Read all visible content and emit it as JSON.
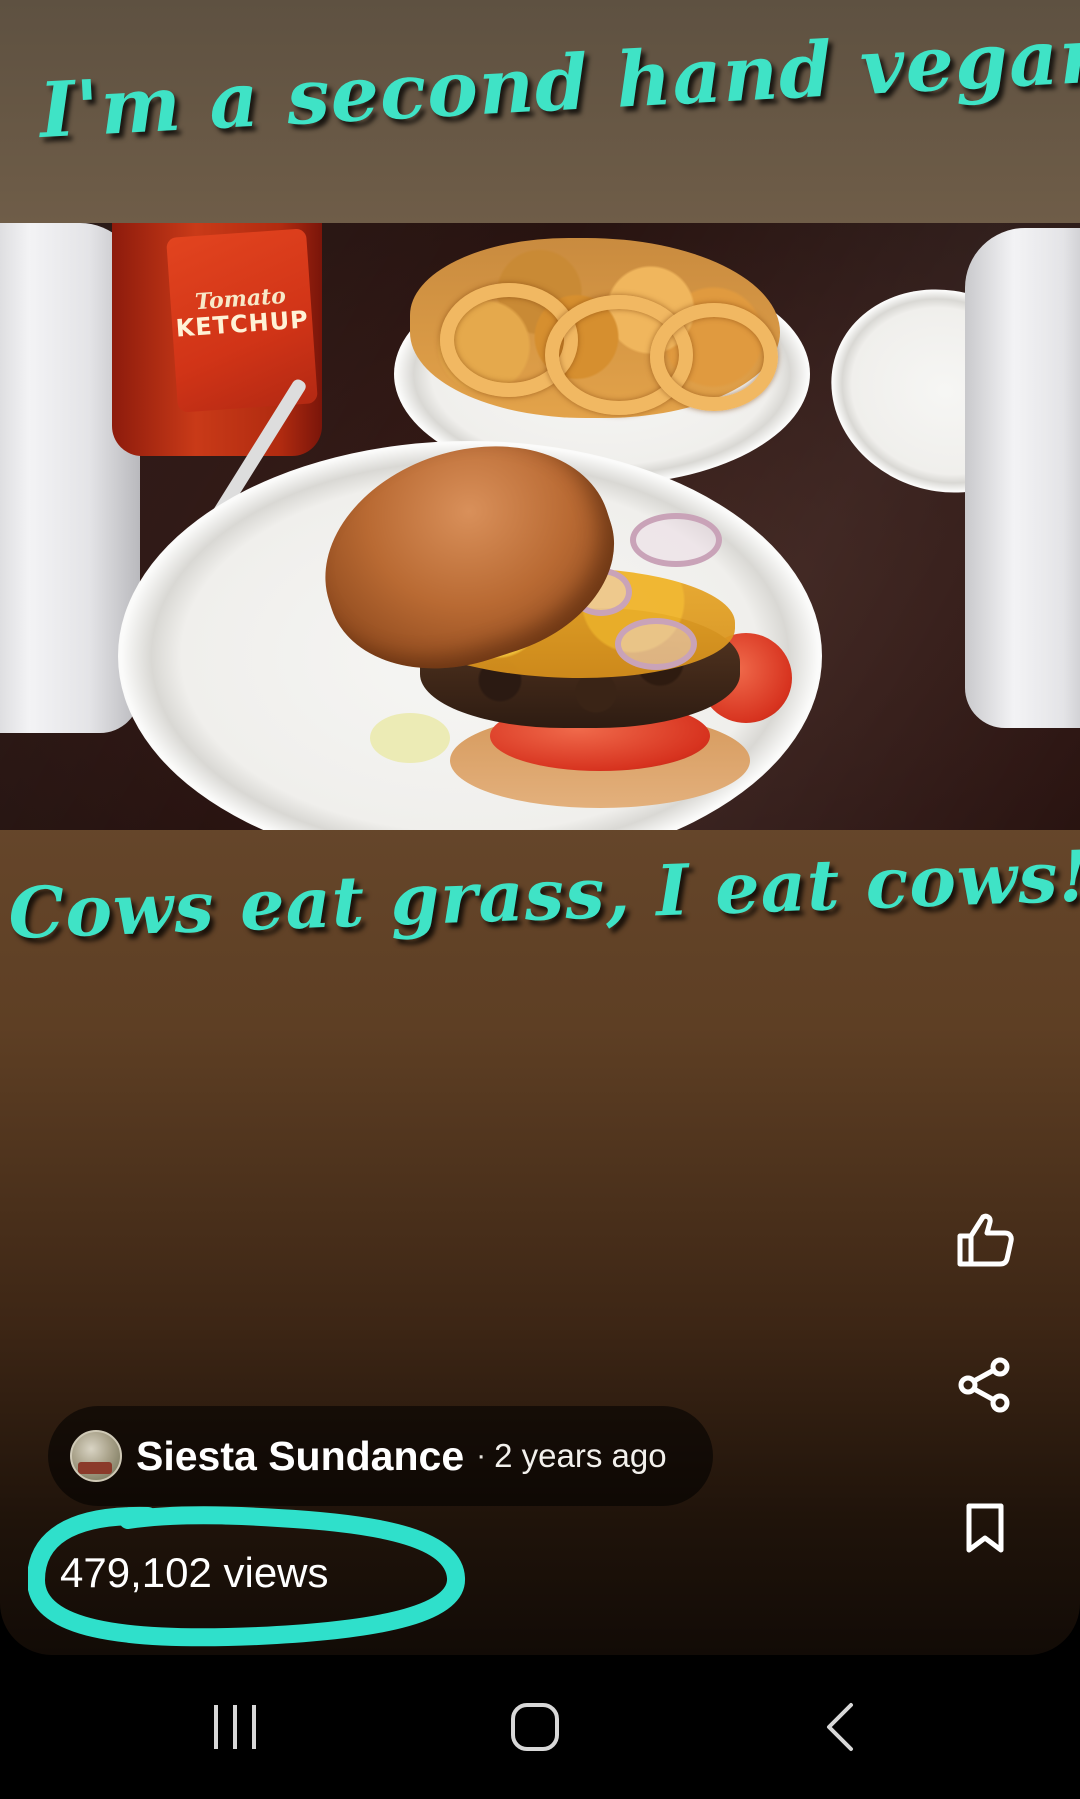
{
  "post": {
    "caption_top": "I'm a second hand vegan.",
    "caption_bottom": "Cows eat grass, I eat cows!",
    "photo_ketchup_brand": "Tomato",
    "photo_ketchup_word": "KETCHUP",
    "author_name": "Siesta Sundance",
    "separator": "·",
    "post_age": "2 years ago",
    "views": "479,102 views"
  },
  "actions": {
    "like_icon": "thumbs-up-icon",
    "share_icon": "share-icon",
    "save_icon": "bookmark-icon"
  },
  "nav": {
    "recents_icon": "recents-icon",
    "home_icon": "home-icon",
    "back_icon": "back-icon"
  },
  "colors": {
    "caption": "#3fe3c6",
    "highlight": "#2fe0cb",
    "background_brown": "#6a4a2e",
    "nav_background": "#000000"
  }
}
